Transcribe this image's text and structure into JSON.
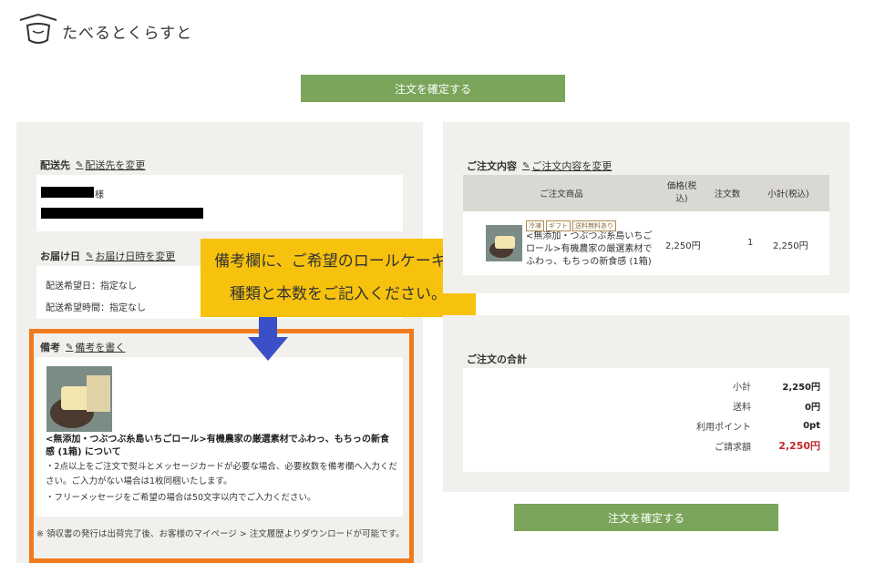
{
  "brand": {
    "name": "たべるとくらすと"
  },
  "buttons": {
    "confirm_top": "注文を確定する",
    "confirm_bottom": "注文を確定する"
  },
  "delivery": {
    "title": "配送先",
    "edit_link": "配送先を変更",
    "honorific": "様"
  },
  "schedule": {
    "title": "お届け日",
    "edit_link": "お届け日時を変更",
    "date_line": "配送希望日：指定なし",
    "time_line": "配送希望時間：指定なし"
  },
  "callout": {
    "line1": "備考欄に、ご希望のロールケーキの",
    "line2": "種類と本数をご記入ください。"
  },
  "remarks": {
    "title": "備考",
    "edit_link": "備考を書く",
    "product_title": "<無添加・つぶつぶ糸島いちごロール>有機農家の厳選素材でふわっ、もちっの新食感 (1箱) について",
    "note1": "・2点以上をご注文で熨斗とメッセージカードが必要な場合、必要枚数を備考欄へ入力ください。ご入力がない場合は1枚同梱いたします。",
    "note2": "・フリーメッセージをご希望の場合は50文字以内でご入力ください。",
    "receipt_note": "※ 領収書の発行は出荷完了後、お客様のマイページ > 注文履歴よりダウンロードが可能です。"
  },
  "order": {
    "title": "ご注文内容",
    "edit_link": "ご注文内容を変更",
    "headers": {
      "product": "ご注文商品",
      "price": "価格(税込)",
      "qty": "注文数",
      "subtotal": "小計(税込)"
    },
    "item": {
      "tags": [
        "冷凍",
        "ギフト",
        "送料無料あり"
      ],
      "name": "<無添加・つぶつぶ糸島いちごロール>有機農家の厳選素材でふわっ、もちっの新食感 (1箱)",
      "price": "2,250円",
      "qty": "1",
      "subtotal": "2,250円"
    }
  },
  "totals": {
    "title": "ご注文の合計",
    "subtotal_label": "小計",
    "subtotal": "2,250円",
    "shipping_label": "送料",
    "shipping": "0円",
    "points_label": "利用ポイント",
    "points": "0pt",
    "billing_label": "ご請求額",
    "billing": "2,250円",
    "billing_color": "#c0282d"
  },
  "colors": {
    "button": "#7aa55a",
    "panel": "#f1f0ec",
    "callout": "#f7c20e",
    "frame": "#f07a1c",
    "arrow": "#3a4fc8"
  }
}
